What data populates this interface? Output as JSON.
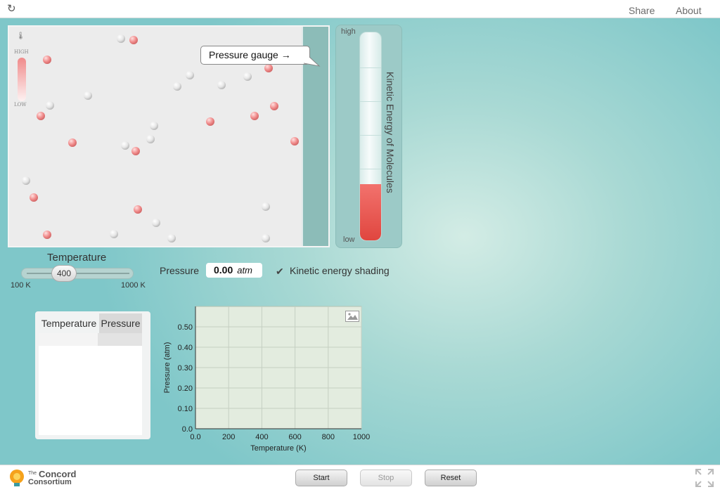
{
  "topbar": {
    "share_label": "Share",
    "about_label": "About"
  },
  "simulation": {
    "legend": {
      "high": "HIGH",
      "low": "LOW"
    },
    "gauge_tooltip": "Pressure gauge →"
  },
  "kinetic_energy_meter": {
    "high_label": "high",
    "low_label": "low",
    "title": "Kinetic Energy of Molecules",
    "level": 0.27
  },
  "temperature_slider": {
    "title": "Temperature",
    "value": "400",
    "min_label": "100 K",
    "max_label": "1000 K"
  },
  "pressure_readout": {
    "label": "Pressure",
    "value": "0.00",
    "unit": "atm"
  },
  "ke_shading": {
    "label": "Kinetic energy shading",
    "checked": true
  },
  "table": {
    "headers": [
      "Temperature",
      "Pressure"
    ],
    "rows": []
  },
  "colors": {
    "accent": "#7fc7c9",
    "molecule_hot": "#e07878",
    "molecule_cold": "#d8d8d8",
    "piston": "#8cbcb8"
  },
  "chart_data": {
    "type": "scatter",
    "xlabel": "Temperature (K)",
    "ylabel": "Pressure (atm)",
    "xlim": [
      0,
      1000
    ],
    "ylim": [
      0,
      0.6
    ],
    "x_ticks": [
      "0.0",
      "200",
      "400",
      "600",
      "800",
      "1000"
    ],
    "y_ticks": [
      "0.0",
      "0.10",
      "0.20",
      "0.30",
      "0.40",
      "0.50"
    ],
    "grid": true,
    "series": [
      {
        "x": [],
        "y": []
      }
    ]
  },
  "footer": {
    "logo_the": "The",
    "logo_line1": "Concord",
    "logo_line2": "Consortium",
    "start_label": "Start",
    "stop_label": "Stop",
    "reset_label": "Reset"
  }
}
